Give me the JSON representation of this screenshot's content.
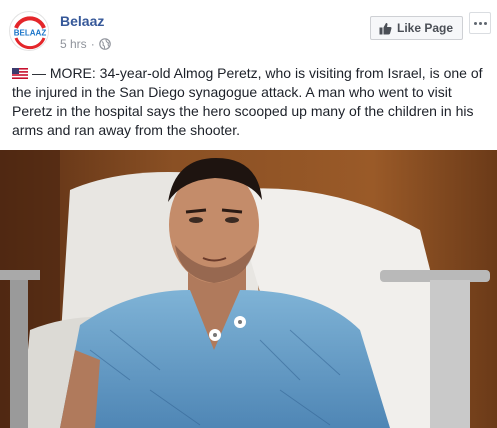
{
  "post": {
    "page_name": "Belaaz",
    "timestamp": "5 hrs",
    "separator": "·",
    "privacy_icon": "globe-icon",
    "like_page_label": "Like Page",
    "like_icon": "thumbs-up-icon",
    "more_icon": "more-options-icon",
    "avatar_text": "BELAAZ",
    "flag_icon": "us-flag-icon",
    "text": "— MORE: 34-year-old Almog Peretz, who is visiting from Israel, is one of the injured in the San Diego synagogue attack. A man who went to visit Peretz in the hospital says the hero scooped up many of the children in his arms and ran away from the shooter.",
    "colors": {
      "link": "#365899",
      "meta": "#90949c",
      "brand_red": "#e4262a",
      "brand_blue": "#1a75c9"
    }
  }
}
